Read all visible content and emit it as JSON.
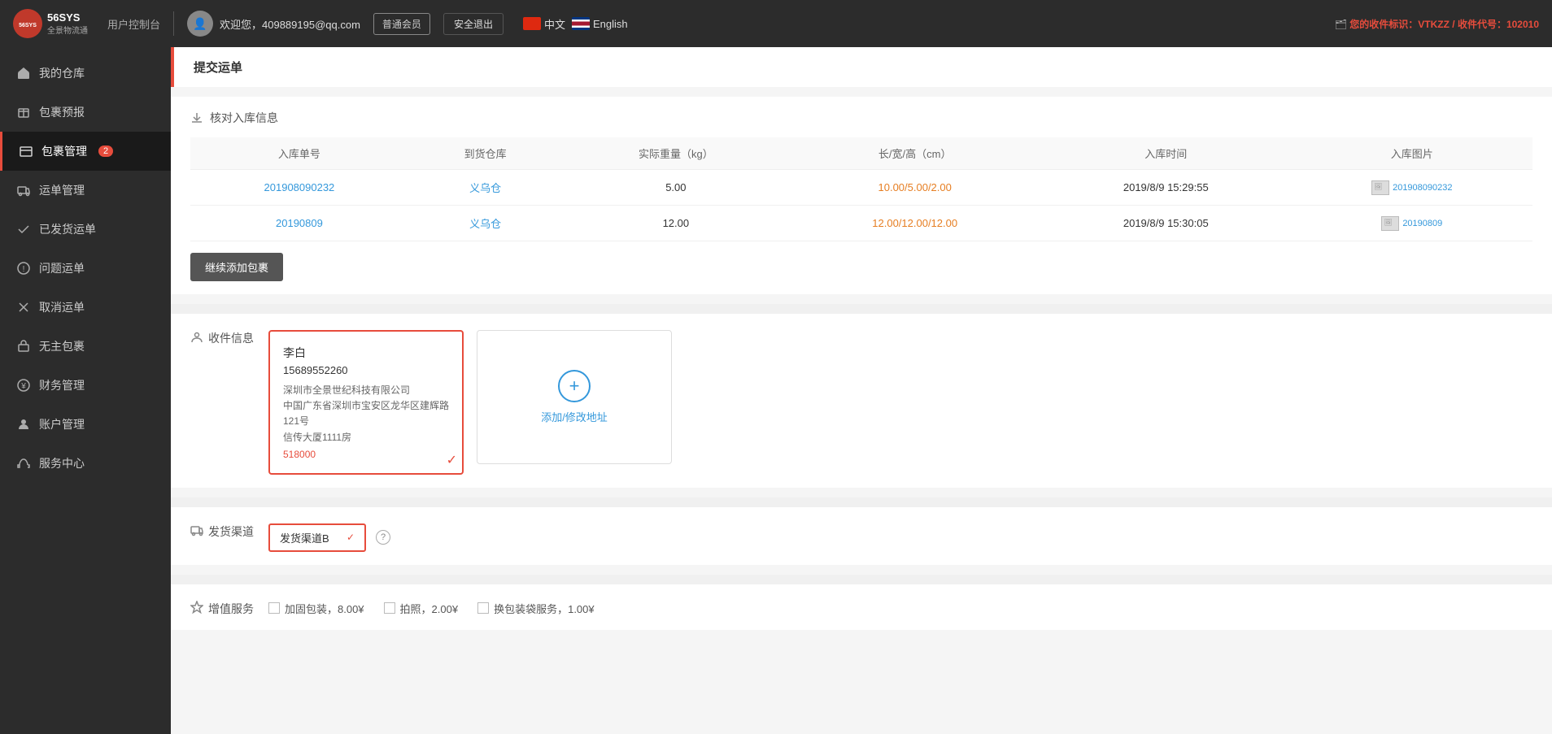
{
  "header": {
    "logo_text": "56SYS",
    "logo_sub": "全景物流通",
    "control_panel": "用户控制台",
    "welcome": "欢迎您，409889195@qq.com",
    "membership": "普通会员",
    "logout": "安全退出",
    "lang_cn": "中文",
    "lang_en": "English",
    "receipt_label": "您的收件标识：VTKZZ / 收件代号：102010"
  },
  "sidebar": {
    "items": [
      {
        "label": "我的仓库",
        "icon": "warehouse",
        "badge": null,
        "active": false
      },
      {
        "label": "包裹预报",
        "icon": "box",
        "badge": null,
        "active": false
      },
      {
        "label": "包裹管理",
        "icon": "package",
        "badge": "2",
        "active": true
      },
      {
        "label": "运单管理",
        "icon": "shipping",
        "badge": null,
        "active": false
      },
      {
        "label": "已发货运单",
        "icon": "sent",
        "badge": null,
        "active": false
      },
      {
        "label": "问题运单",
        "icon": "issue",
        "badge": null,
        "active": false
      },
      {
        "label": "取消运单",
        "icon": "cancel",
        "badge": null,
        "active": false
      },
      {
        "label": "无主包裹",
        "icon": "unclaimed",
        "badge": null,
        "active": false
      },
      {
        "label": "财务管理",
        "icon": "finance",
        "badge": null,
        "active": false
      },
      {
        "label": "账户管理",
        "icon": "account",
        "badge": null,
        "active": false
      },
      {
        "label": "服务中心",
        "icon": "service",
        "badge": null,
        "active": false
      }
    ]
  },
  "page": {
    "title": "提交运单",
    "sections": {
      "warehouse_info": {
        "title": "核对入库信息",
        "table": {
          "headers": [
            "入库单号",
            "到货仓库",
            "实际重量（kg）",
            "长/宽/高（cm）",
            "入库时间",
            "入库图片"
          ],
          "rows": [
            {
              "order_no": "201908090232",
              "warehouse": "义乌仓",
              "weight": "5.00",
              "dimensions": "10.00/5.00/2.00",
              "time": "2019/8/9 15:29:55",
              "image": "201908090232"
            },
            {
              "order_no": "20190809",
              "warehouse": "义乌仓",
              "weight": "12.00",
              "dimensions": "12.00/12.00/12.00",
              "time": "2019/8/9 15:30:05",
              "image": "20190809"
            }
          ]
        },
        "continue_btn": "继续添加包裹"
      },
      "recipient_info": {
        "title": "收件信息",
        "address": {
          "name": "李白",
          "phone": "15689552260",
          "company": "深圳市全景世纪科技有限公司",
          "address_line1": "中国广东省深圳市宝安区龙华区建辉路",
          "address_line2": "121号",
          "building": "信传大厦1111房",
          "zip": "518000"
        },
        "add_btn_label": "添加/修改地址"
      },
      "shipping_channel": {
        "title": "发货渠道",
        "selected": "发货渠道B"
      },
      "value_added": {
        "title": "增值服务",
        "options": [
          {
            "label": "加固包装，8.00¥"
          },
          {
            "label": "拍照，2.00¥"
          },
          {
            "label": "换包装袋服务，1.00¥"
          }
        ]
      }
    }
  }
}
